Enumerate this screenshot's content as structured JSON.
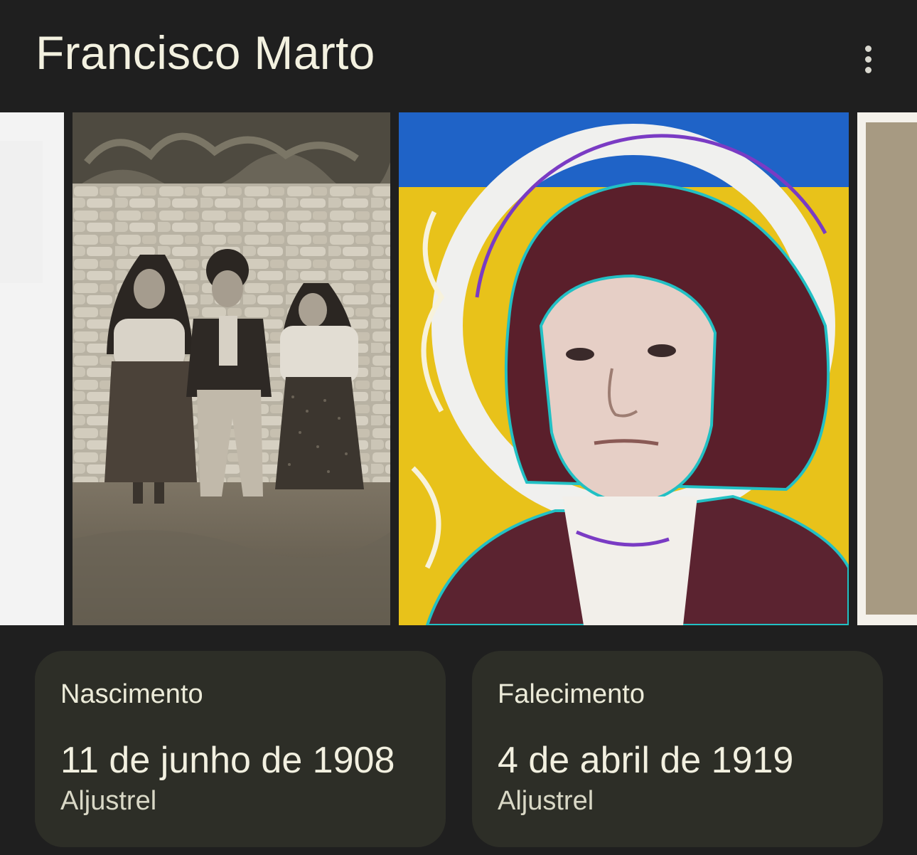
{
  "header": {
    "title": "Francisco Marto",
    "menu_icon": "more-vert-icon"
  },
  "carousel": {
    "images": [
      {
        "name": "image-partial-left",
        "subject": "light partial image"
      },
      {
        "name": "image-three-children",
        "subject": "sepia photo of three children in front of stone wall"
      },
      {
        "name": "image-portrait-halo",
        "subject": "colorized portrait of boy with halo on blue and yellow background"
      },
      {
        "name": "image-partial-right",
        "subject": "partial sepia image"
      }
    ]
  },
  "facts": {
    "birth": {
      "label": "Nascimento",
      "date": "11 de junho de 1908",
      "place": "Aljustrel"
    },
    "death": {
      "label": "Falecimento",
      "date": "4 de abril de 1919",
      "place": "Aljustrel"
    }
  },
  "colors": {
    "background": "#1f1f1f",
    "card": "#2d2e27",
    "text": "#f1f0df"
  }
}
